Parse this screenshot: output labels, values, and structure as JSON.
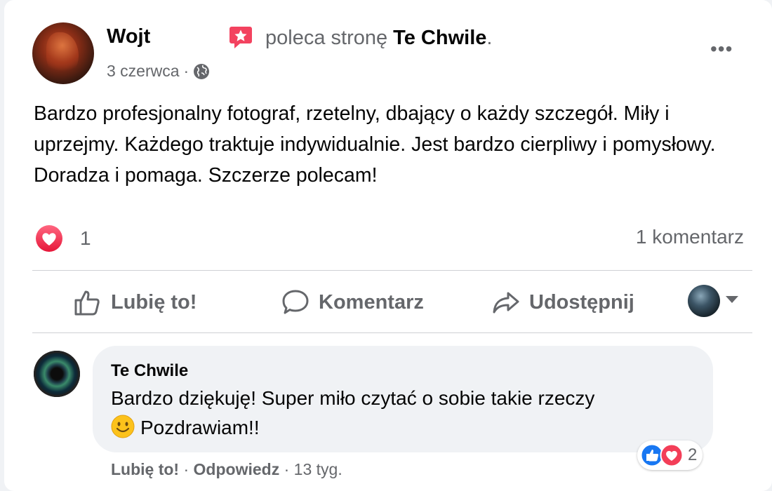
{
  "post": {
    "author": "Wojt",
    "recommend_text": "poleca stronę ",
    "page_name": "Te Chwile",
    "page_suffix": ".",
    "date": "3 czerwca",
    "date_sep": "·",
    "privacy_icon": "globe-icon",
    "more_label": "•••",
    "body": "Bardzo profesjonalny fotograf, rzetelny, dbający o każdy szczegół. Miły i uprzejmy. Każdego traktuje indywidualnie. Jest bardzo cierpliwy i pomysłowy. Doradza i pomaga. Szczerze polecam!"
  },
  "stats": {
    "reaction_icon": "love-reaction-icon",
    "reaction_count": "1",
    "comments": "1 komentarz"
  },
  "actions": {
    "like": "Lubię to!",
    "comment": "Komentarz",
    "share": "Udostępnij"
  },
  "comment": {
    "author": "Te Chwile",
    "line1": "Bardzo dziękuję! Super miło czytać o sobie takie rzeczy",
    "line2": "Pozdrawiam!!",
    "reaction_count": "2",
    "like": "Lubię to!",
    "reply": "Odpowiedz",
    "sep": " · ",
    "time": "13 tyg."
  },
  "colors": {
    "love": "#f33e58",
    "like_blue": "#1877f2",
    "recommend_red": "#f3425f",
    "secondary_text": "#65676b"
  }
}
